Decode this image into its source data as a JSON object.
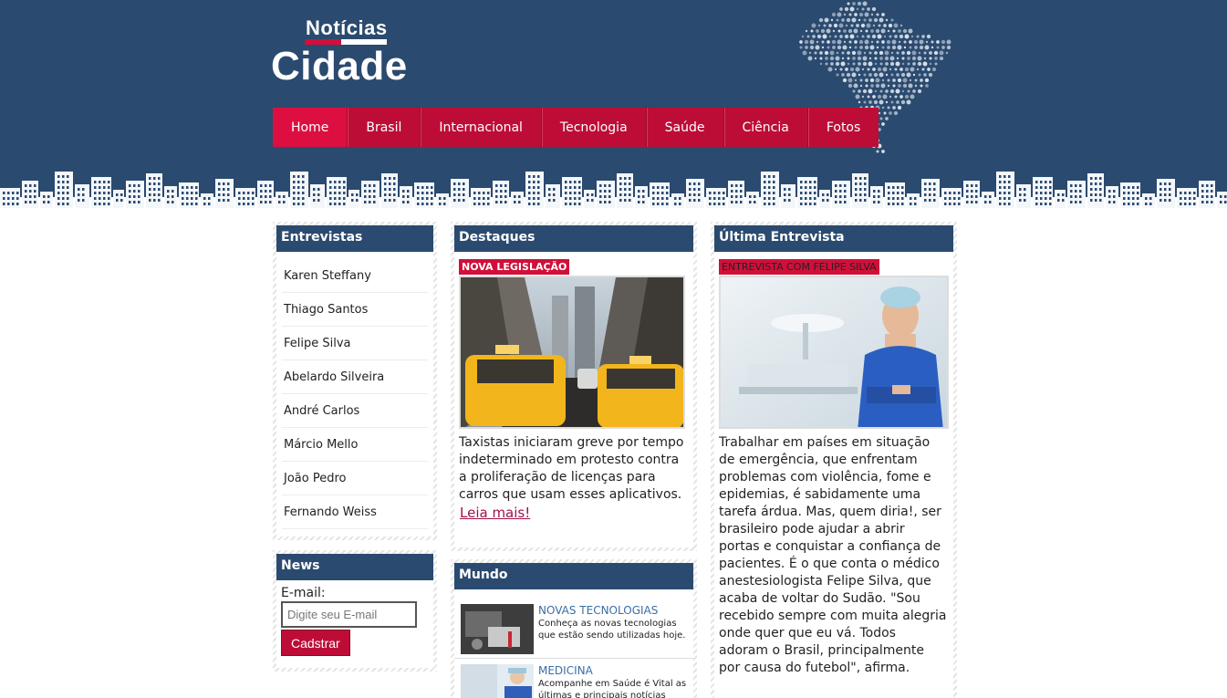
{
  "logo": {
    "top": "Notícias",
    "main": "Cidade"
  },
  "nav": [
    {
      "label": "Home",
      "active": true
    },
    {
      "label": "Brasil"
    },
    {
      "label": "Internacional"
    },
    {
      "label": "Tecnologia"
    },
    {
      "label": "Saúde"
    },
    {
      "label": "Ciência"
    },
    {
      "label": "Fotos"
    }
  ],
  "interviews": {
    "title": "Entrevistas",
    "items": [
      "Karen Steffany",
      "Thiago Santos",
      "Felipe Silva",
      "Abelardo Silveira",
      "André Carlos",
      "Márcio Mello",
      "João Pedro",
      "Fernando Weiss"
    ]
  },
  "news": {
    "title": "News",
    "email_label": "E-mail:",
    "email_placeholder": "Digite seu E-mail",
    "button_label": "Cadstrar"
  },
  "highlights": {
    "title": "Destaques",
    "tag": "NOVA LEGISLAÇÃO",
    "text": "Taxistas iniciaram greve por tempo indeterminado em protesto contra a proliferação de licenças para carros que usam esses aplicativos.",
    "read_more": "Leia mais!"
  },
  "world": {
    "title": "Mundo",
    "items": [
      {
        "title": "NOVAS TECNOLOGIAS",
        "desc": "Conheça as novas tecnologias que estão sendo utilizadas hoje."
      },
      {
        "title": "MEDICINA",
        "desc": "Acompanhe em Saúde é Vital as últimas e principais notícias"
      }
    ]
  },
  "last_interview": {
    "title": "Última Entrevista",
    "tag": "ENTREVISTA COM FELIPE SILVA",
    "text": "Trabalhar em países em situação de emergência, que enfrentam problemas com violência, fome e epidemias, é sabidamente uma tarefa árdua. Mas, quem diria!, ser brasileiro pode ajudar a abrir portas e conquistar a confiança de pacientes. É o que conta o médico anestesiologista Felipe Silva, que acaba de voltar do Sudão. \"Sou recebido sempre com muita alegria onde quer que eu vá. Todos adoram o Brasil, principalmente por causa do futebol\", afirma."
  },
  "colors": {
    "header_blue": "#2b4a6f",
    "nav_red": "#bd0d37",
    "nav_active": "#dc0f40",
    "tag_red": "#d0103a",
    "link_blue": "#3a6ea5"
  }
}
